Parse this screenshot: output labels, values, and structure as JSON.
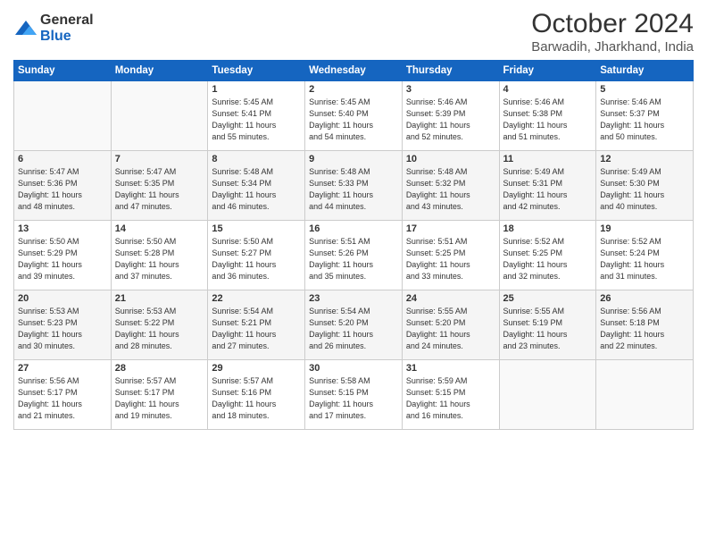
{
  "logo": {
    "line1": "General",
    "line2": "Blue"
  },
  "header": {
    "month": "October 2024",
    "location": "Barwadih, Jharkhand, India"
  },
  "weekdays": [
    "Sunday",
    "Monday",
    "Tuesday",
    "Wednesday",
    "Thursday",
    "Friday",
    "Saturday"
  ],
  "weeks": [
    [
      {
        "day": "",
        "info": ""
      },
      {
        "day": "",
        "info": ""
      },
      {
        "day": "1",
        "info": "Sunrise: 5:45 AM\nSunset: 5:41 PM\nDaylight: 11 hours\nand 55 minutes."
      },
      {
        "day": "2",
        "info": "Sunrise: 5:45 AM\nSunset: 5:40 PM\nDaylight: 11 hours\nand 54 minutes."
      },
      {
        "day": "3",
        "info": "Sunrise: 5:46 AM\nSunset: 5:39 PM\nDaylight: 11 hours\nand 52 minutes."
      },
      {
        "day": "4",
        "info": "Sunrise: 5:46 AM\nSunset: 5:38 PM\nDaylight: 11 hours\nand 51 minutes."
      },
      {
        "day": "5",
        "info": "Sunrise: 5:46 AM\nSunset: 5:37 PM\nDaylight: 11 hours\nand 50 minutes."
      }
    ],
    [
      {
        "day": "6",
        "info": "Sunrise: 5:47 AM\nSunset: 5:36 PM\nDaylight: 11 hours\nand 48 minutes."
      },
      {
        "day": "7",
        "info": "Sunrise: 5:47 AM\nSunset: 5:35 PM\nDaylight: 11 hours\nand 47 minutes."
      },
      {
        "day": "8",
        "info": "Sunrise: 5:48 AM\nSunset: 5:34 PM\nDaylight: 11 hours\nand 46 minutes."
      },
      {
        "day": "9",
        "info": "Sunrise: 5:48 AM\nSunset: 5:33 PM\nDaylight: 11 hours\nand 44 minutes."
      },
      {
        "day": "10",
        "info": "Sunrise: 5:48 AM\nSunset: 5:32 PM\nDaylight: 11 hours\nand 43 minutes."
      },
      {
        "day": "11",
        "info": "Sunrise: 5:49 AM\nSunset: 5:31 PM\nDaylight: 11 hours\nand 42 minutes."
      },
      {
        "day": "12",
        "info": "Sunrise: 5:49 AM\nSunset: 5:30 PM\nDaylight: 11 hours\nand 40 minutes."
      }
    ],
    [
      {
        "day": "13",
        "info": "Sunrise: 5:50 AM\nSunset: 5:29 PM\nDaylight: 11 hours\nand 39 minutes."
      },
      {
        "day": "14",
        "info": "Sunrise: 5:50 AM\nSunset: 5:28 PM\nDaylight: 11 hours\nand 37 minutes."
      },
      {
        "day": "15",
        "info": "Sunrise: 5:50 AM\nSunset: 5:27 PM\nDaylight: 11 hours\nand 36 minutes."
      },
      {
        "day": "16",
        "info": "Sunrise: 5:51 AM\nSunset: 5:26 PM\nDaylight: 11 hours\nand 35 minutes."
      },
      {
        "day": "17",
        "info": "Sunrise: 5:51 AM\nSunset: 5:25 PM\nDaylight: 11 hours\nand 33 minutes."
      },
      {
        "day": "18",
        "info": "Sunrise: 5:52 AM\nSunset: 5:25 PM\nDaylight: 11 hours\nand 32 minutes."
      },
      {
        "day": "19",
        "info": "Sunrise: 5:52 AM\nSunset: 5:24 PM\nDaylight: 11 hours\nand 31 minutes."
      }
    ],
    [
      {
        "day": "20",
        "info": "Sunrise: 5:53 AM\nSunset: 5:23 PM\nDaylight: 11 hours\nand 30 minutes."
      },
      {
        "day": "21",
        "info": "Sunrise: 5:53 AM\nSunset: 5:22 PM\nDaylight: 11 hours\nand 28 minutes."
      },
      {
        "day": "22",
        "info": "Sunrise: 5:54 AM\nSunset: 5:21 PM\nDaylight: 11 hours\nand 27 minutes."
      },
      {
        "day": "23",
        "info": "Sunrise: 5:54 AM\nSunset: 5:20 PM\nDaylight: 11 hours\nand 26 minutes."
      },
      {
        "day": "24",
        "info": "Sunrise: 5:55 AM\nSunset: 5:20 PM\nDaylight: 11 hours\nand 24 minutes."
      },
      {
        "day": "25",
        "info": "Sunrise: 5:55 AM\nSunset: 5:19 PM\nDaylight: 11 hours\nand 23 minutes."
      },
      {
        "day": "26",
        "info": "Sunrise: 5:56 AM\nSunset: 5:18 PM\nDaylight: 11 hours\nand 22 minutes."
      }
    ],
    [
      {
        "day": "27",
        "info": "Sunrise: 5:56 AM\nSunset: 5:17 PM\nDaylight: 11 hours\nand 21 minutes."
      },
      {
        "day": "28",
        "info": "Sunrise: 5:57 AM\nSunset: 5:17 PM\nDaylight: 11 hours\nand 19 minutes."
      },
      {
        "day": "29",
        "info": "Sunrise: 5:57 AM\nSunset: 5:16 PM\nDaylight: 11 hours\nand 18 minutes."
      },
      {
        "day": "30",
        "info": "Sunrise: 5:58 AM\nSunset: 5:15 PM\nDaylight: 11 hours\nand 17 minutes."
      },
      {
        "day": "31",
        "info": "Sunrise: 5:59 AM\nSunset: 5:15 PM\nDaylight: 11 hours\nand 16 minutes."
      },
      {
        "day": "",
        "info": ""
      },
      {
        "day": "",
        "info": ""
      }
    ]
  ]
}
